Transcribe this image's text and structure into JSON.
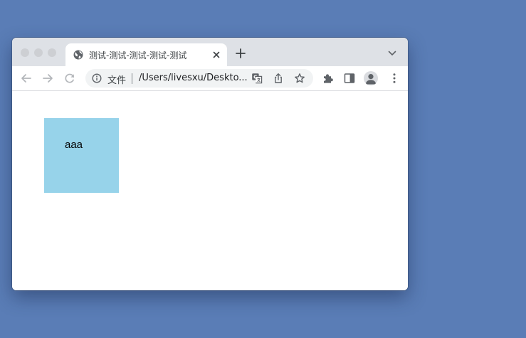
{
  "tab": {
    "title": "测试-测试-测试-测试-测试",
    "favicon": "globe-icon"
  },
  "toolbar": {
    "scheme_label": "文件",
    "url": "/Users/livesxu/Deskto..."
  },
  "page": {
    "box_text": "aaa",
    "box_color": "#97d3ea"
  },
  "colors": {
    "desktop_background": "#5a7db6",
    "tabstrip_background": "#dee1e6"
  }
}
